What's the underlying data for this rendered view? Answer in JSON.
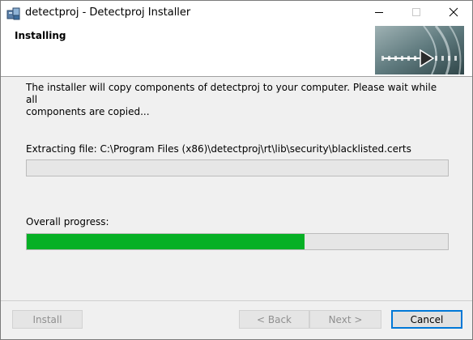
{
  "window": {
    "title": "detectproj - Detectproj Installer"
  },
  "header": {
    "title": "Installing"
  },
  "main": {
    "description": "The installer will copy components of detectproj to your computer. Please wait while all\ncomponents are copied...",
    "extracting_text": "Extracting file: C:\\Program Files (x86)\\detectproj\\rt\\lib\\security\\blacklisted.certs",
    "file_progress": 0,
    "overall_label": "Overall progress:",
    "overall_progress": 0.66
  },
  "buttons": {
    "install": "Install",
    "back": "< Back",
    "next": "Next >",
    "cancel": "Cancel"
  },
  "colors": {
    "progress_fill": "#06b025",
    "default_button_border": "#0078d7"
  },
  "icons": {
    "app": "installer-icon",
    "minimize": "minimize-icon",
    "maximize": "maximize-icon",
    "close": "close-icon",
    "banner": "banner-arrow-graphic"
  }
}
